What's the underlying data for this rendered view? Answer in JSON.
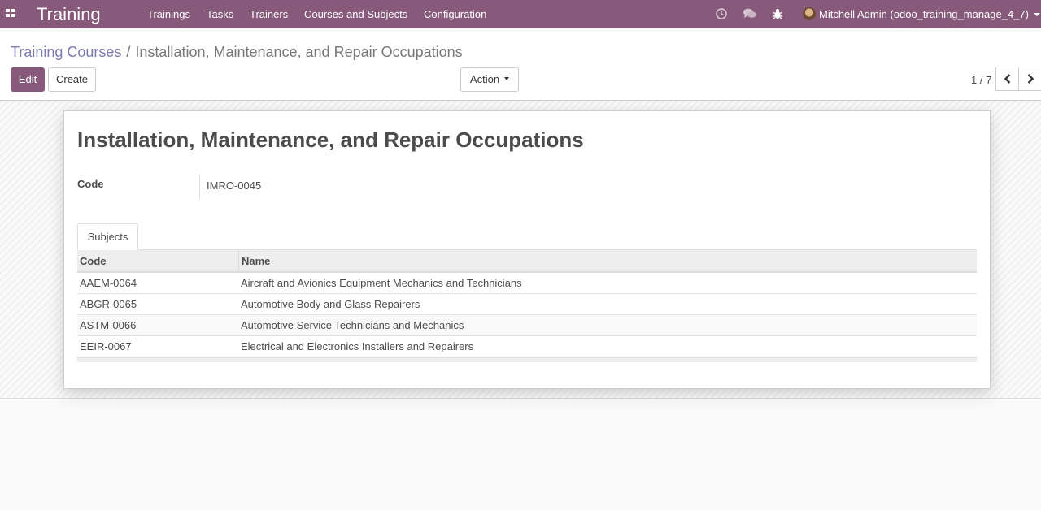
{
  "navbar": {
    "brand": "Training",
    "menus": [
      "Trainings",
      "Tasks",
      "Trainers",
      "Courses and Subjects",
      "Configuration"
    ],
    "user": "Mitchell Admin (odoo_training_manage_4_7)",
    "icons": [
      "apps-icon",
      "clock-icon",
      "chat-icon",
      "bug-icon"
    ]
  },
  "breadcrumb": {
    "parent": "Training Courses",
    "separator": "/",
    "current": "Installation, Maintenance, and Repair Occupations"
  },
  "buttons": {
    "edit": "Edit",
    "create": "Create",
    "action": "Action"
  },
  "pager": "1 / 7",
  "form": {
    "title": "Installation, Maintenance, and Repair Occupations",
    "code_label": "Code",
    "code_value": "IMRO-0045",
    "tab": "Subjects",
    "columns": [
      "Code",
      "Name"
    ],
    "rows": [
      {
        "code": "AAEM-0064",
        "name": "Aircraft and Avionics Equipment Mechanics and Technicians"
      },
      {
        "code": "ABGR-0065",
        "name": "Automotive Body and Glass Repairers"
      },
      {
        "code": "ASTM-0066",
        "name": "Automotive Service Technicians and Mechanics"
      },
      {
        "code": "EEIR-0067",
        "name": "Electrical and Electronics Installers and Repairers"
      }
    ]
  },
  "colors": {
    "brand": "#875a7b",
    "link": "#7c7bad"
  }
}
